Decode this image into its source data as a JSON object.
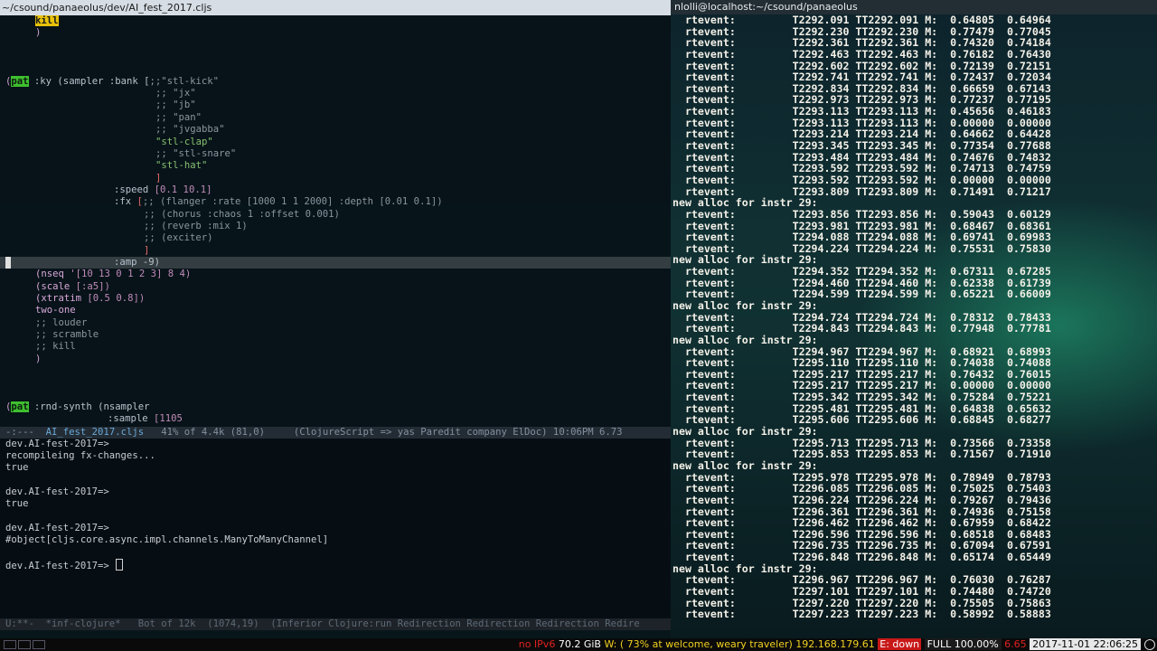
{
  "left": {
    "title": "~/csound/panaeolus/dev/AI_fest_2017.cljs",
    "modeline_editor": {
      "prefix": "-:---",
      "filename": "AI_fest_2017.cljs",
      "rest": "41% of 4.4k (81,0)     (ClojureScript => yas Paredit company ElDoc) 10:06PM 6.73"
    },
    "modeline_repl": "U:**-  *inf-clojure*   Bot of 12k  (1074,19)  (Inferior Clojure:run Redirection Redirection Redirection Redire",
    "code": {
      "kill_top": "kill",
      "close_paren_top": ")",
      "pat": "pat",
      "ky_line": ":ky (sampler :bank [",
      "bank_first": ";;\"stl-kick\"",
      "bank_jx": ";; \"jx\"",
      "bank_jb": ";; \"jb\"",
      "bank_pan": ";; \"pan\"",
      "bank_jvgabba": ";; \"jvgabba\"",
      "bank_clap": "\"stl-clap\"",
      "bank_snare": ";; \"stl-snare\"",
      "bank_hat": "\"stl-hat\"",
      "bank_close": "]",
      "speed_kw": ":speed",
      "speed_val": "[0.1 10.1]",
      "fx_kw": ":fx",
      "fx_bracket": "[",
      "fx_flanger": ";; (flanger :rate [1000 1 1 2000] :depth [0.01 0.1])",
      "fx_chorus": ";; (chorus :chaos 1 :offset 0.001)",
      "fx_reverb": ";; (reverb :mix 1)",
      "fx_exciter": ";; (exciter)",
      "fx_close": "]",
      "amp_line": ":amp -9)",
      "nseq_fn": "nseq",
      "nseq_args": " '[10 13 0 1 2 3] 8 4)",
      "scale_fn": "scale",
      "scale_args": " [:a5])",
      "xtratim_fn": "xtratim",
      "xtratim_args": " [0.5 0.8])",
      "two_one": "two-one",
      "c_louder": ";; louder",
      "c_scramble": ";; scramble",
      "c_kill": ";; kill",
      "close_paren": ")",
      "rnd_line": ":rnd-synth (nsampler",
      "sample_kw": ":sample",
      "sample_val": "[1105"
    },
    "repl": [
      "dev.AI-fest-2017=>",
      "recompileing fx-changes...",
      "true",
      "",
      "dev.AI-fest-2017=>",
      "true",
      "",
      "dev.AI-fest-2017=>",
      "#object[cljs.core.async.impl.channels.ManyToManyChannel]",
      "",
      "dev.AI-fest-2017=> "
    ]
  },
  "right": {
    "title": "nlolli@localhost:~/csound/panaeolus",
    "lines": [
      "  rtevent:         T2292.091 TT2292.091 M:  0.64805  0.64964",
      "  rtevent:         T2292.230 TT2292.230 M:  0.77479  0.77045",
      "  rtevent:         T2292.361 TT2292.361 M:  0.74320  0.74184",
      "  rtevent:         T2292.463 TT2292.463 M:  0.76182  0.76430",
      "  rtevent:         T2292.602 TT2292.602 M:  0.72139  0.72151",
      "  rtevent:         T2292.741 TT2292.741 M:  0.72437  0.72034",
      "  rtevent:         T2292.834 TT2292.834 M:  0.66659  0.67143",
      "  rtevent:         T2292.973 TT2292.973 M:  0.77237  0.77195",
      "  rtevent:         T2293.113 TT2293.113 M:  0.45656  0.46183",
      "  rtevent:         T2293.113 TT2293.113 M:  0.00000  0.00000",
      "  rtevent:         T2293.214 TT2293.214 M:  0.64662  0.64428",
      "  rtevent:         T2293.345 TT2293.345 M:  0.77354  0.77688",
      "  rtevent:         T2293.484 TT2293.484 M:  0.74676  0.74832",
      "  rtevent:         T2293.592 TT2293.592 M:  0.74713  0.74759",
      "  rtevent:         T2293.592 TT2293.592 M:  0.00000  0.00000",
      "  rtevent:         T2293.809 TT2293.809 M:  0.71491  0.71217",
      "new alloc for instr 29:",
      "  rtevent:         T2293.856 TT2293.856 M:  0.59043  0.60129",
      "  rtevent:         T2293.981 TT2293.981 M:  0.68467  0.68361",
      "  rtevent:         T2294.088 TT2294.088 M:  0.69741  0.69983",
      "  rtevent:         T2294.224 TT2294.224 M:  0.75531  0.75830",
      "new alloc for instr 29:",
      "  rtevent:         T2294.352 TT2294.352 M:  0.67311  0.67285",
      "  rtevent:         T2294.460 TT2294.460 M:  0.62338  0.61739",
      "  rtevent:         T2294.599 TT2294.599 M:  0.65221  0.66009",
      "new alloc for instr 29:",
      "  rtevent:         T2294.724 TT2294.724 M:  0.78312  0.78433",
      "  rtevent:         T2294.843 TT2294.843 M:  0.77948  0.77781",
      "new alloc for instr 29:",
      "  rtevent:         T2294.967 TT2294.967 M:  0.68921  0.68993",
      "  rtevent:         T2295.110 TT2295.110 M:  0.74038  0.74088",
      "  rtevent:         T2295.217 TT2295.217 M:  0.76432  0.76015",
      "  rtevent:         T2295.217 TT2295.217 M:  0.00000  0.00000",
      "  rtevent:         T2295.342 TT2295.342 M:  0.75284  0.75221",
      "  rtevent:         T2295.481 TT2295.481 M:  0.64838  0.65632",
      "  rtevent:         T2295.606 TT2295.606 M:  0.68845  0.68277",
      "new alloc for instr 29:",
      "  rtevent:         T2295.713 TT2295.713 M:  0.73566  0.73358",
      "  rtevent:         T2295.853 TT2295.853 M:  0.71567  0.71910",
      "new alloc for instr 29:",
      "  rtevent:         T2295.978 TT2295.978 M:  0.78949  0.78793",
      "  rtevent:         T2296.085 TT2296.085 M:  0.75025  0.75403",
      "  rtevent:         T2296.224 TT2296.224 M:  0.79267  0.79436",
      "  rtevent:         T2296.361 TT2296.361 M:  0.74936  0.75158",
      "  rtevent:         T2296.462 TT2296.462 M:  0.67959  0.68422",
      "  rtevent:         T2296.596 TT2296.596 M:  0.68518  0.68483",
      "  rtevent:         T2296.735 TT2296.735 M:  0.67094  0.67591",
      "  rtevent:         T2296.848 TT2296.848 M:  0.65174  0.65449",
      "new alloc for instr 29:",
      "  rtevent:         T2296.967 TT2296.967 M:  0.76030  0.76287",
      "  rtevent:         T2297.101 TT2297.101 M:  0.74480  0.74720",
      "  rtevent:         T2297.220 TT2297.220 M:  0.75505  0.75863",
      "  rtevent:         T2297.223 TT2297.223 M:  0.58992  0.58883"
    ]
  },
  "statusbar": {
    "left_fragment": "no IPv6",
    "disk": "70.2 GiB",
    "wifi": "W: ( 73% at welcome, weary traveler) 192.168.179.61",
    "eth": "E: down",
    "battery": "FULL 100.00%",
    "load": "6.65",
    "datetime": "2017-11-01 22:06:25"
  },
  "colors": {
    "accent_green": "#3fbf2f",
    "highlight_yellow": "#e8c20a",
    "error_red": "#c81818"
  }
}
